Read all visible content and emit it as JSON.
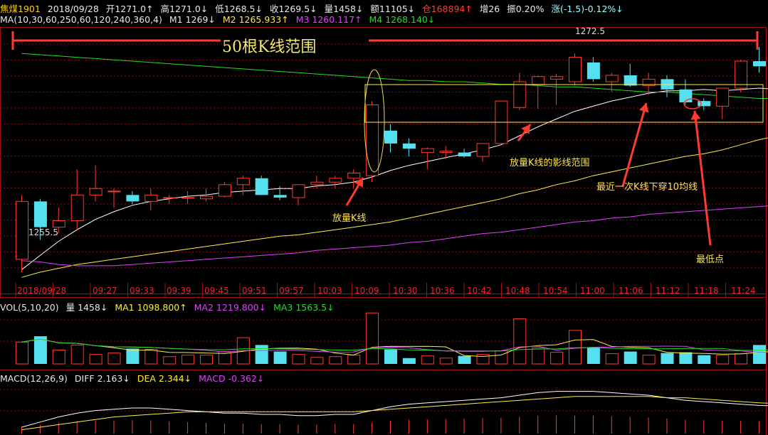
{
  "header": {
    "symbol": "焦煤1901",
    "date": "2018/09/28",
    "open": "开1271.0↑",
    "high": "高1271.0↓",
    "low": "低1268.5↓",
    "close": "收1269.5↓",
    "volume": "量1458↓",
    "amount": "额11105↓",
    "position": "仓168894↑",
    "increase": "增26",
    "amplitude": "振0.20%",
    "change": "涨(-1.5)-0.12%↓"
  },
  "ma_legend": {
    "label": "MA(10,30,60,250,60,120,240,360,4)",
    "m1": "M1 1269↓",
    "m2": "M2 1265.933↑",
    "m3": "M3 1260.117↑",
    "m4": "M4 1268.140↓"
  },
  "vol_legend": {
    "label": "VOL(5,10,20)",
    "vol": "量 1458↓",
    "ma1": "MA1 1098.800↑",
    "ma2": "MA2 1219.800↓",
    "ma3": "MA3 1563.5↓"
  },
  "macd_legend": {
    "label": "MACD(12,26,9)",
    "diff": "DIFF 2.163↓",
    "dea": "DEA 2.344↓",
    "macd": "MACD -0.362↓"
  },
  "annotations": {
    "range_50": "50根K线范围",
    "volume_k": "放量K线",
    "shadow_range": "放量K线的影线范围",
    "cross_ma10": "最近一次K线下穿10均线",
    "lowest": "最低点"
  },
  "colors": {
    "up": "#ff3b30",
    "down": "#55e0f0",
    "ma1": "#ffffff",
    "ma2": "#ffee44",
    "ma3": "#e040fb",
    "ma4": "#22dd22",
    "annotation": "#ffe24a"
  },
  "chart_data": {
    "type": "candlestick",
    "price_labels": {
      "high": "1272.5",
      "low": "1255.5"
    },
    "x_labels": [
      "2018/09/28",
      "09:27",
      "09:33",
      "09:39",
      "09:45",
      "09:51",
      "09:57",
      "10:03",
      "10:09",
      "10:30",
      "10:36",
      "10:42",
      "10:48",
      "10:54",
      "11:00",
      "11:06",
      "11:12",
      "11:18",
      "11:24"
    ],
    "ylim": [
      1254.5,
      1273.5
    ],
    "candles": [
      {
        "o": 1256.0,
        "h": 1261.0,
        "l": 1255.0,
        "c": 1260.5
      },
      {
        "o": 1260.5,
        "h": 1260.7,
        "l": 1257.5,
        "c": 1258.5
      },
      {
        "o": 1258.5,
        "h": 1260.0,
        "l": 1258.0,
        "c": 1259.0
      },
      {
        "o": 1259.0,
        "h": 1263.0,
        "l": 1258.2,
        "c": 1261.0
      },
      {
        "o": 1261.0,
        "h": 1263.3,
        "l": 1260.5,
        "c": 1261.5
      },
      {
        "o": 1261.3,
        "h": 1261.5,
        "l": 1260.0,
        "c": 1261.3
      },
      {
        "o": 1261.0,
        "h": 1261.3,
        "l": 1260.3,
        "c": 1260.5
      },
      {
        "o": 1260.5,
        "h": 1261.5,
        "l": 1259.8,
        "c": 1261.0
      },
      {
        "o": 1260.8,
        "h": 1261.0,
        "l": 1260.3,
        "c": 1260.8
      },
      {
        "o": 1260.8,
        "h": 1261.3,
        "l": 1260.3,
        "c": 1260.8
      },
      {
        "o": 1260.7,
        "h": 1261.5,
        "l": 1260.5,
        "c": 1260.9
      },
      {
        "o": 1260.9,
        "h": 1262.0,
        "l": 1260.8,
        "c": 1261.8
      },
      {
        "o": 1261.8,
        "h": 1262.5,
        "l": 1261.0,
        "c": 1262.3
      },
      {
        "o": 1262.3,
        "h": 1262.5,
        "l": 1261.0,
        "c": 1261.0
      },
      {
        "o": 1261.0,
        "h": 1261.7,
        "l": 1260.6,
        "c": 1260.8
      },
      {
        "o": 1260.8,
        "h": 1261.8,
        "l": 1260.2,
        "c": 1261.8
      },
      {
        "o": 1261.8,
        "h": 1262.5,
        "l": 1261.5,
        "c": 1262.0
      },
      {
        "o": 1262.0,
        "h": 1262.5,
        "l": 1261.5,
        "c": 1262.3
      },
      {
        "o": 1262.3,
        "h": 1263.0,
        "l": 1261.5,
        "c": 1262.7
      },
      {
        "o": 1262.5,
        "h": 1268.3,
        "l": 1262.0,
        "c": 1268.0
      },
      {
        "o": 1266.0,
        "h": 1266.5,
        "l": 1264.3,
        "c": 1265.0
      },
      {
        "o": 1265.0,
        "h": 1265.4,
        "l": 1264.0,
        "c": 1264.6
      },
      {
        "o": 1264.3,
        "h": 1264.7,
        "l": 1263.0,
        "c": 1264.6
      },
      {
        "o": 1264.3,
        "h": 1264.8,
        "l": 1263.8,
        "c": 1264.4
      },
      {
        "o": 1264.3,
        "h": 1264.6,
        "l": 1263.9,
        "c": 1264.0
      },
      {
        "o": 1264.0,
        "h": 1265.0,
        "l": 1263.6,
        "c": 1265.0
      },
      {
        "o": 1265.0,
        "h": 1268.3,
        "l": 1265.0,
        "c": 1268.3
      },
      {
        "o": 1267.8,
        "h": 1270.5,
        "l": 1267.6,
        "c": 1269.8
      },
      {
        "o": 1269.6,
        "h": 1270.3,
        "l": 1267.7,
        "c": 1270.2
      },
      {
        "o": 1270.0,
        "h": 1270.4,
        "l": 1268.0,
        "c": 1270.2
      },
      {
        "o": 1269.8,
        "h": 1272.0,
        "l": 1269.5,
        "c": 1271.7
      },
      {
        "o": 1271.3,
        "h": 1271.7,
        "l": 1269.8,
        "c": 1270.0
      },
      {
        "o": 1269.8,
        "h": 1270.5,
        "l": 1269.0,
        "c": 1270.3
      },
      {
        "o": 1270.3,
        "h": 1271.2,
        "l": 1269.4,
        "c": 1269.5
      },
      {
        "o": 1269.5,
        "h": 1270.5,
        "l": 1268.8,
        "c": 1270.0
      },
      {
        "o": 1270.0,
        "h": 1270.3,
        "l": 1268.6,
        "c": 1269.2
      },
      {
        "o": 1269.2,
        "h": 1270.0,
        "l": 1268.0,
        "c": 1268.2
      },
      {
        "o": 1268.3,
        "h": 1268.5,
        "l": 1267.6,
        "c": 1267.9
      },
      {
        "o": 1267.9,
        "h": 1269.3,
        "l": 1266.9,
        "c": 1269.3
      },
      {
        "o": 1269.3,
        "h": 1271.5,
        "l": 1269.0,
        "c": 1271.4
      },
      {
        "o": 1271.4,
        "h": 1272.5,
        "l": 1270.5,
        "c": 1271.0
      },
      {
        "o": 1271.0,
        "h": 1271.1,
        "l": 1269.5,
        "c": 1269.5
      }
    ],
    "volume": [
      1500,
      1900,
      950,
      1300,
      650,
      750,
      1050,
      1000,
      500,
      600,
      600,
      850,
      1800,
      1300,
      850,
      650,
      450,
      500,
      600,
      3500,
      1000,
      400,
      550,
      400,
      550,
      650,
      900,
      3100,
      1100,
      800,
      2300,
      1100,
      700,
      850,
      600,
      750,
      800,
      600,
      600,
      700,
      1300,
      1200
    ],
    "ma_lines": [
      {
        "name": "M1",
        "points": [
          1255.2,
          1256.3,
          1257.4,
          1258.3,
          1259.1,
          1259.7,
          1260.2,
          1260.5,
          1260.7,
          1260.9,
          1261.0,
          1261.2,
          1261.3,
          1261.4,
          1261.5,
          1261.5,
          1261.7,
          1261.8,
          1262.0,
          1262.4,
          1262.9,
          1263.3,
          1263.6,
          1263.9,
          1264.2,
          1264.5,
          1264.9,
          1265.6,
          1266.3,
          1266.9,
          1267.5,
          1267.9,
          1268.3,
          1268.6,
          1268.9,
          1269.1,
          1269.1,
          1269.2,
          1269.1,
          1269.2,
          1269.3,
          1269.2
        ]
      },
      {
        "name": "M2",
        "points": [
          1254.6,
          1255.0,
          1255.3,
          1255.6,
          1255.8,
          1256.0,
          1256.2,
          1256.4,
          1256.6,
          1256.8,
          1257.0,
          1257.2,
          1257.4,
          1257.6,
          1257.8,
          1257.9,
          1258.1,
          1258.3,
          1258.5,
          1258.7,
          1258.9,
          1259.2,
          1259.5,
          1259.8,
          1260.1,
          1260.4,
          1260.7,
          1261.1,
          1261.4,
          1261.8,
          1262.1,
          1262.5,
          1262.8,
          1263.1,
          1263.4,
          1263.7,
          1264.0,
          1264.2,
          1264.5,
          1264.9,
          1265.3,
          1265.6
        ]
      },
      {
        "name": "M3",
        "points": [
          1255.9,
          1255.8,
          1255.6,
          1255.5,
          1255.5,
          1255.5,
          1255.6,
          1255.7,
          1255.8,
          1255.9,
          1256.0,
          1256.1,
          1256.2,
          1256.3,
          1256.4,
          1256.5,
          1256.7,
          1256.8,
          1256.9,
          1257.0,
          1257.1,
          1257.3,
          1257.4,
          1257.6,
          1257.8,
          1258.0,
          1258.1,
          1258.3,
          1258.5,
          1258.7,
          1258.9,
          1259.0,
          1259.2,
          1259.3,
          1259.5,
          1259.6,
          1259.7,
          1259.8,
          1259.9,
          1260.0,
          1260.1,
          1260.2
        ]
      },
      {
        "name": "M4",
        "points": [
          1272.0,
          1271.9,
          1271.8,
          1271.7,
          1271.6,
          1271.5,
          1271.4,
          1271.3,
          1271.2,
          1271.1,
          1271.0,
          1270.9,
          1270.8,
          1270.7,
          1270.6,
          1270.5,
          1270.4,
          1270.3,
          1270.2,
          1270.1,
          1270.0,
          1269.9,
          1269.9,
          1269.8,
          1269.8,
          1269.7,
          1269.6,
          1269.6,
          1269.5,
          1269.4,
          1269.4,
          1269.3,
          1269.2,
          1269.1,
          1269.0,
          1269.0,
          1268.9,
          1268.8,
          1268.7,
          1268.6,
          1268.5,
          1268.5
        ]
      }
    ],
    "macd": {
      "diff": [
        0.5,
        0.9,
        1.3,
        1.6,
        1.8,
        1.9,
        2.0,
        2.0,
        1.9,
        1.8,
        1.7,
        1.6,
        1.6,
        1.5,
        1.5,
        1.4,
        1.4,
        1.5,
        1.5,
        1.8,
        2.1,
        2.3,
        2.4,
        2.5,
        2.6,
        2.7,
        2.8,
        3.0,
        3.2,
        3.3,
        3.3,
        3.3,
        3.2,
        3.1,
        3.0,
        2.8,
        2.6,
        2.5,
        2.4,
        2.3,
        2.2,
        2.163
      ],
      "dea": [
        0.3,
        0.5,
        0.7,
        0.9,
        1.1,
        1.3,
        1.4,
        1.5,
        1.6,
        1.7,
        1.7,
        1.7,
        1.7,
        1.7,
        1.7,
        1.7,
        1.7,
        1.7,
        1.7,
        1.8,
        1.9,
        2.0,
        2.1,
        2.2,
        2.3,
        2.4,
        2.5,
        2.6,
        2.7,
        2.8,
        2.9,
        2.9,
        2.9,
        2.9,
        2.9,
        2.8,
        2.8,
        2.7,
        2.6,
        2.5,
        2.4,
        2.344
      ]
    }
  }
}
